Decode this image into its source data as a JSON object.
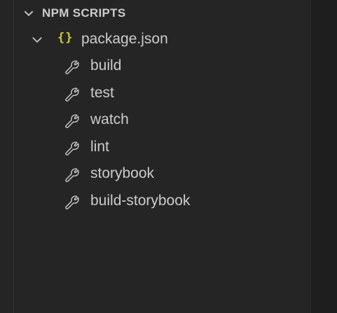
{
  "section": {
    "title": "NPM SCRIPTS",
    "expanded": true
  },
  "package": {
    "braces": "{}",
    "label": "package.json",
    "expanded": true
  },
  "scripts": [
    {
      "label": "build",
      "icon": "wrench-icon"
    },
    {
      "label": "test",
      "icon": "wrench-icon"
    },
    {
      "label": "watch",
      "icon": "wrench-icon"
    },
    {
      "label": "lint",
      "icon": "wrench-icon"
    },
    {
      "label": "storybook",
      "icon": "wrench-icon"
    },
    {
      "label": "build-storybook",
      "icon": "wrench-icon"
    }
  ],
  "colors": {
    "panel_bg": "#252526",
    "editor_bg": "#1e1e1e",
    "text": "#cccccc",
    "json_icon": "#cbcb41"
  }
}
